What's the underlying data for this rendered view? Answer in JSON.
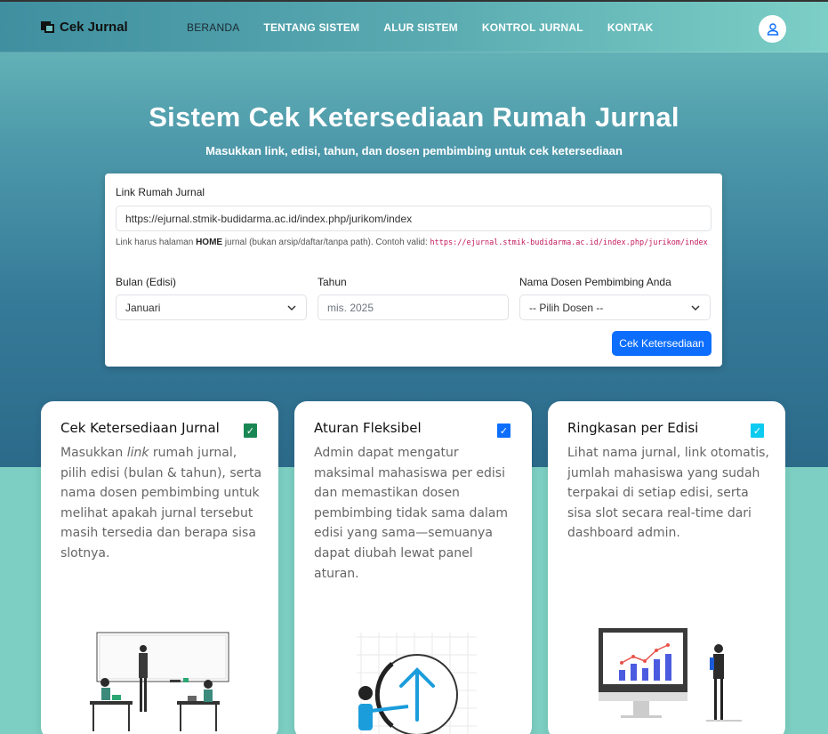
{
  "nav": {
    "brand": "Cek Jurnal",
    "items": [
      {
        "label": "BERANDA",
        "active": true
      },
      {
        "label": "TENTANG SISTEM"
      },
      {
        "label": "ALUR SISTEM"
      },
      {
        "label": "KONTROL JURNAL"
      },
      {
        "label": "KONTAK"
      }
    ],
    "user_icon": "user-icon"
  },
  "hero": {
    "title": "Sistem Cek Ketersediaan Rumah Jurnal",
    "subtitle": "Masukkan link, edisi, tahun, dan dosen pembimbing untuk cek ketersediaan"
  },
  "form": {
    "link_label": "Link Rumah Jurnal",
    "link_value": "https://ejurnal.stmik-budidarma.ac.id/index.php/jurikom/index",
    "help_prefix": "Link harus halaman ",
    "help_bold": "HOME",
    "help_suffix": " jurnal (bukan arsip/daftar/tanpa path). Contoh valid: ",
    "help_code": "https://ejurnal.stmik-budidarma.ac.id/index.php/jurikom/index",
    "month_label": "Bulan (Edisi)",
    "month_value": "Januari",
    "year_label": "Tahun",
    "year_placeholder": "mis. 2025",
    "lecturer_label": "Nama Dosen Pembimbing Anda",
    "lecturer_value": "-- Pilih Dosen --",
    "submit_label": "Cek Ketersediaan"
  },
  "cards": [
    {
      "title": "Cek Ketersediaan Jurnal",
      "text_before": "Masukkan ",
      "text_em": "link",
      "text_after": " rumah jurnal, pilih edisi (bulan & tahun), serta nama dosen pembimbing untuk melihat apakah jurnal tersebut masih tersedia dan berapa sisa slotnya.",
      "check_color": "#198754"
    },
    {
      "title": "Aturan Fleksibel",
      "text": "Admin dapat mengatur maksimal mahasiswa per edisi dan memastikan dosen pembimbing tidak sama dalam edisi yang sama—semuanya dapat diubah lewat panel aturan.",
      "check_color": "#0d6efd"
    },
    {
      "title": "Ringkasan per Edisi",
      "text": "Lihat nama jurnal, link otomatis, jumlah mahasiswa yang sudah terpakai di setiap edisi, serta sisa slot secara real-time dari dashboard admin.",
      "check_color": "#0dcaf0"
    }
  ],
  "colors": {
    "primary": "#0d6efd",
    "teal": "#7ccfc2"
  }
}
